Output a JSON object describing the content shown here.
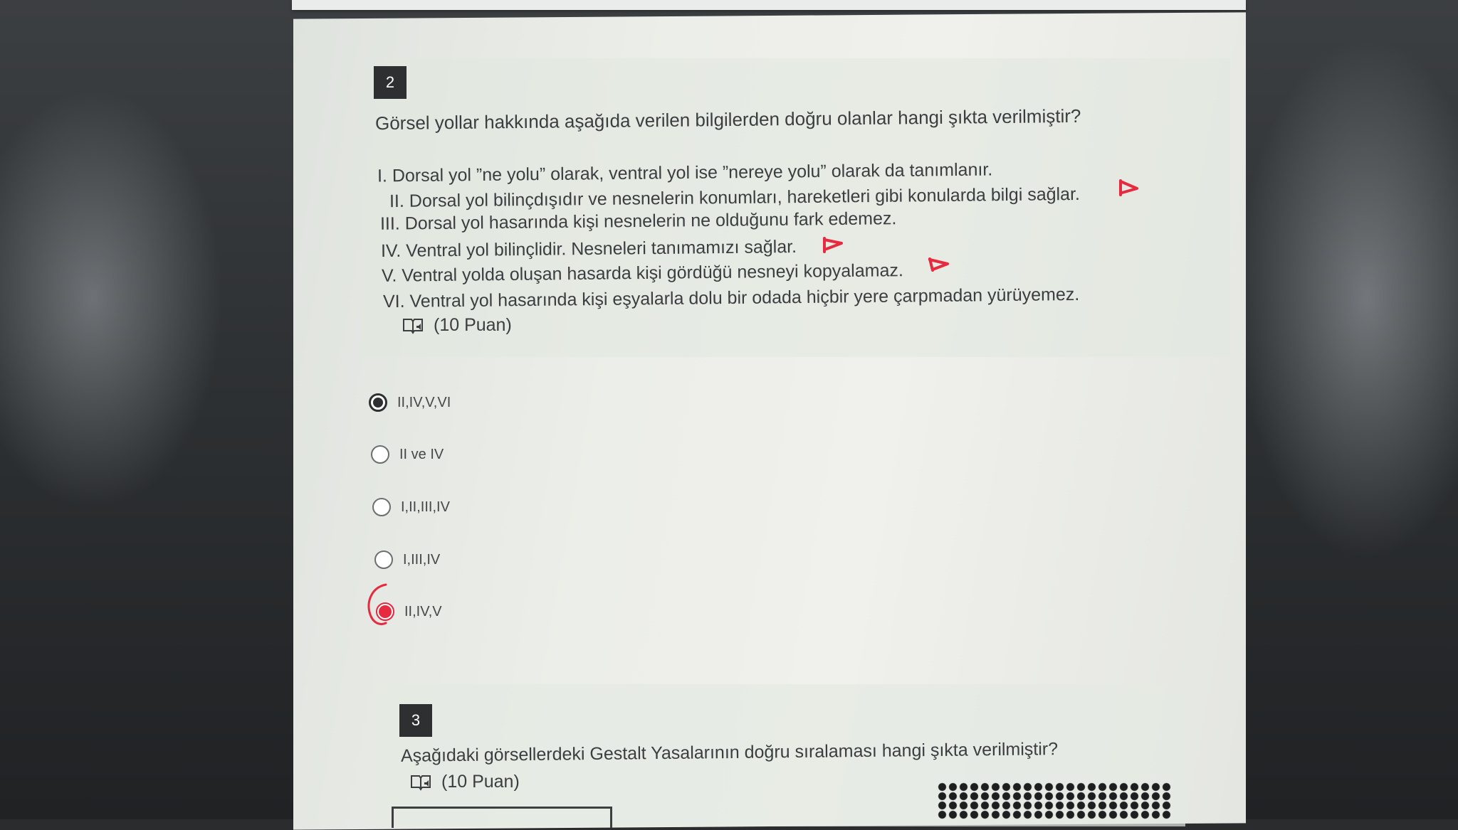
{
  "colors": {
    "accent_red": "#e62a3f",
    "badge_bg": "#2d2f31",
    "text": "#3b3d40"
  },
  "question2": {
    "number": "2",
    "text": "Görsel yollar hakkında aşağıda verilen bilgilerden doğru olanlar hangi şıkta verilmiştir?",
    "statements": [
      "I. Dorsal yol ”ne yolu” olarak, ventral yol ise ”nereye yolu” olarak da tanımlanır.",
      "II. Dorsal yol bilinçdışıdır ve nesnelerin konumları, hareketleri gibi konularda bilgi sağlar.",
      "III. Dorsal yol hasarında kişi nesnelerin ne olduğunu fark edemez.",
      "IV. Ventral yol bilinçlidir. Nesneleri tanımamızı sağlar.",
      "V. Ventral yolda oluşan hasarda kişi gördüğü nesneyi kopyalamaz.",
      "VI. Ventral yol hasarında kişi eşyalarla dolu bir odada hiçbir yere çarpmadan yürüyemez."
    ],
    "points": "(10 Puan)",
    "reader_icon": "immersive-reader-icon",
    "options": [
      {
        "label": "II,IV,V,VI",
        "state": "selected"
      },
      {
        "label": "II ve IV",
        "state": "empty"
      },
      {
        "label": "I,II,III,IV",
        "state": "empty"
      },
      {
        "label": "I,III,IV",
        "state": "empty"
      },
      {
        "label": "II,IV,V",
        "state": "red-marked"
      }
    ]
  },
  "question3": {
    "number": "3",
    "text": "Aşağıdaki görsellerdeki Gestalt Yasalarının doğru sıralaması hangi şıkta verilmiştir?",
    "points": "(10 Puan)",
    "reader_icon": "immersive-reader-icon"
  }
}
